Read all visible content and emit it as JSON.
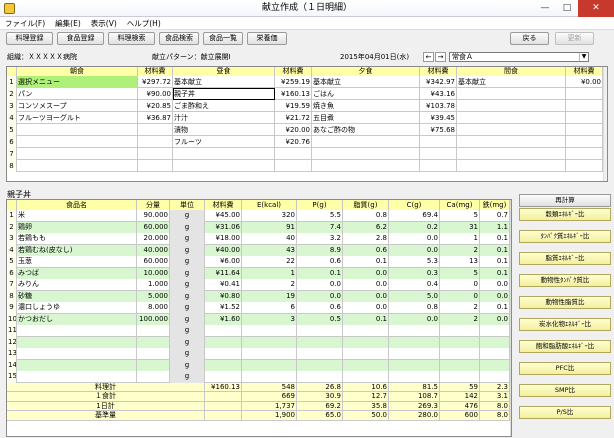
{
  "window": {
    "title": "献立作成（１日明細）",
    "minimize": "—",
    "maximize": "□",
    "close": "✕"
  },
  "menu": [
    "ファイル(F)",
    "編集(E)",
    "表示(V)",
    "ヘルプ(H)"
  ],
  "toolbar": {
    "left": [
      "料理登録",
      "食品登録",
      "料理検索",
      "食品検索",
      "食品一覧",
      "栄養価"
    ],
    "back": "戻る",
    "update": "更新"
  },
  "info": {
    "org": "組織：ＸＸＸＸＸ病院",
    "pattern": "献立パターン：献立展開Ⅰ",
    "date": "2015年04月01日(水)",
    "prev": "←",
    "next": "→",
    "meal_type": "常食Ａ"
  },
  "meal_grid": {
    "headers": [
      "朝食",
      "材料費",
      "昼食",
      "材料費",
      "夕食",
      "材料費",
      "間食",
      "材料費"
    ],
    "row_numbers": [
      "1",
      "2",
      "3",
      "4",
      "5",
      "6",
      "7",
      "8"
    ],
    "rows": [
      [
        "選択メニュー",
        "¥297.72",
        "基本献立",
        "¥259.19",
        "基本献立",
        "¥342.97",
        "基本献立",
        "¥0.00"
      ],
      [
        "パン",
        "¥90.00",
        "親子丼",
        "¥160.13",
        "ごはん",
        "¥43.16",
        "",
        ""
      ],
      [
        "コンソメスープ",
        "¥20.85",
        "ごま酢和え",
        "¥19.59",
        "焼き魚",
        "¥103.78",
        "",
        ""
      ],
      [
        "フルーツヨーグルト",
        "¥36.87",
        "汁汁",
        "¥21.72",
        "五目煮",
        "¥39.45",
        "",
        ""
      ],
      [
        "",
        "",
        "漬物",
        "¥20.00",
        "あなご酢の物",
        "¥75.68",
        "",
        ""
      ],
      [
        "",
        "",
        "フルーツ",
        "¥20.76",
        "",
        "",
        "",
        ""
      ],
      [
        "",
        "",
        "",
        "",
        "",
        "",
        "",
        ""
      ],
      [
        "",
        "",
        "",
        "",
        "",
        "",
        "",
        ""
      ]
    ]
  },
  "dish_title": "親子丼",
  "ingredient_grid": {
    "headers": [
      "食品名",
      "分量",
      "単位",
      "材料費",
      "E(kcal)",
      "P(g)",
      "脂質(g)",
      "C(g)",
      "Ca(mg)",
      "鉄(mg)"
    ],
    "rows": [
      [
        "1",
        "米",
        "90.000",
        "g",
        "¥45.00",
        "320",
        "5.5",
        "0.8",
        "69.4",
        "5",
        "0.7"
      ],
      [
        "2",
        "鶏卵",
        "60.000",
        "g",
        "¥31.06",
        "91",
        "7.4",
        "6.2",
        "0.2",
        "31",
        "1.1"
      ],
      [
        "3",
        "若鶏もも",
        "20.000",
        "g",
        "¥18.00",
        "40",
        "3.2",
        "2.8",
        "0.0",
        "1",
        "0.1"
      ],
      [
        "4",
        "若鶏むね(皮なし)",
        "40.000",
        "g",
        "¥40.00",
        "43",
        "8.9",
        "0.6",
        "0.0",
        "2",
        "0.1"
      ],
      [
        "5",
        "玉葱",
        "60.000",
        "g",
        "¥6.00",
        "22",
        "0.6",
        "0.1",
        "5.3",
        "13",
        "0.1"
      ],
      [
        "6",
        "みつば",
        "10.000",
        "g",
        "¥11.64",
        "1",
        "0.1",
        "0.0",
        "0.3",
        "5",
        "0.1"
      ],
      [
        "7",
        "みりん",
        "1.000",
        "g",
        "¥0.41",
        "2",
        "0.0",
        "0.0",
        "0.4",
        "0",
        "0.0"
      ],
      [
        "8",
        "砂糖",
        "5.000",
        "g",
        "¥0.80",
        "19",
        "0.0",
        "0.0",
        "5.0",
        "0",
        "0.0"
      ],
      [
        "9",
        "濃口しょうゆ",
        "8.000",
        "g",
        "¥1.52",
        "6",
        "0.6",
        "0.0",
        "0.8",
        "2",
        "0.1"
      ],
      [
        "10",
        "かつおだし",
        "100.000",
        "g",
        "¥1.60",
        "3",
        "0.5",
        "0.1",
        "0.0",
        "2",
        "0.0"
      ],
      [
        "11",
        "",
        "",
        "g",
        "",
        "",
        "",
        "",
        "",
        "",
        ""
      ],
      [
        "12",
        "",
        "",
        "g",
        "",
        "",
        "",
        "",
        "",
        "",
        ""
      ],
      [
        "13",
        "",
        "",
        "g",
        "",
        "",
        "",
        "",
        "",
        "",
        ""
      ],
      [
        "14",
        "",
        "",
        "g",
        "",
        "",
        "",
        "",
        "",
        "",
        ""
      ],
      [
        "15",
        "",
        "",
        "g",
        "",
        "",
        "",
        "",
        "",
        "",
        ""
      ]
    ],
    "summary": [
      [
        "料理計",
        "¥160.13",
        "548",
        "26.8",
        "10.6",
        "81.5",
        "59",
        "2.3"
      ],
      [
        "１食計",
        "",
        "669",
        "30.9",
        "12.7",
        "108.7",
        "142",
        "3.1"
      ],
      [
        "1日計",
        "",
        "1,737",
        "69.2",
        "35.8",
        "269.3",
        "476",
        "8.0"
      ],
      [
        "基準量",
        "",
        "1,900",
        "65.0",
        "50.0",
        "280.0",
        "600",
        "8.0"
      ]
    ]
  },
  "right_panel": {
    "recalc": "再計算",
    "buttons": [
      "穀類ｴﾈﾙｷﾞｰ比",
      "ﾀﾝﾊﾟｸ質ｴﾈﾙｷﾞｰ比",
      "脂質ｴﾈﾙｷﾞｰ比",
      "動物性ﾀﾝﾊﾟｸ質比",
      "動物性脂質比",
      "炭水化物ｴﾈﾙｷﾞｰ比",
      "飽和脂肪酸ｴﾈﾙｷﾞｰ比",
      "PFC比",
      "SMP比",
      "P/S比"
    ]
  }
}
